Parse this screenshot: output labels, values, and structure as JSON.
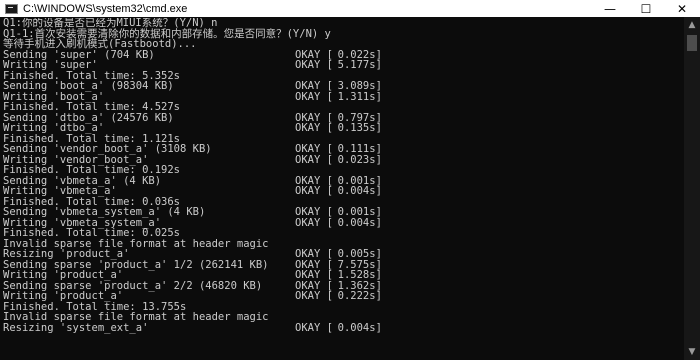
{
  "window": {
    "title": "C:\\WINDOWS\\system32\\cmd.exe",
    "minimize": "—",
    "maximize": "☐",
    "close": "✕"
  },
  "scrollbar": {
    "up": "▲",
    "down": "▼"
  },
  "console": {
    "lines": [
      {
        "left": "Q1:你的设备是否已经为MIUI系统？(Y/N) n"
      },
      {
        "left": "Q1-1:首次安装需要清除你的数据和内部存储。您是否同意？(Y/N) y"
      },
      {
        "left": "等待手机进入刷机模式(Fastbootd)..."
      },
      {
        "left": "Sending 'super' (704 KB)",
        "status": "OKAY [",
        "time": "  0.022s]"
      },
      {
        "left": "Writing 'super'",
        "status": "OKAY [",
        "time": "  5.177s]"
      },
      {
        "left": "Finished. Total time: 5.352s"
      },
      {
        "left": "Sending 'boot_a' (98304 KB)",
        "status": "OKAY [",
        "time": "  3.089s]"
      },
      {
        "left": "Writing 'boot_a'",
        "status": "OKAY [",
        "time": "  1.311s]"
      },
      {
        "left": "Finished. Total time: 4.527s"
      },
      {
        "left": "Sending 'dtbo_a' (24576 KB)",
        "status": "OKAY [",
        "time": "  0.797s]"
      },
      {
        "left": "Writing 'dtbo_a'",
        "status": "OKAY [",
        "time": "  0.135s]"
      },
      {
        "left": "Finished. Total time: 1.121s"
      },
      {
        "left": "Sending 'vendor_boot_a' (3108 KB)",
        "status": "OKAY [",
        "time": "  0.111s]"
      },
      {
        "left": "Writing 'vendor_boot_a'",
        "status": "OKAY [",
        "time": "  0.023s]"
      },
      {
        "left": "Finished. Total time: 0.192s"
      },
      {
        "left": "Sending 'vbmeta_a' (4 KB)",
        "status": "OKAY [",
        "time": "  0.001s]"
      },
      {
        "left": "Writing 'vbmeta_a'",
        "status": "OKAY [",
        "time": "  0.004s]"
      },
      {
        "left": "Finished. Total time: 0.036s"
      },
      {
        "left": "Sending 'vbmeta_system_a' (4 KB)",
        "status": "OKAY [",
        "time": "  0.001s]"
      },
      {
        "left": "Writing 'vbmeta_system_a'",
        "status": "OKAY [",
        "time": "  0.004s]"
      },
      {
        "left": "Finished. Total time: 0.025s"
      },
      {
        "left": "Invalid sparse file format at header magic"
      },
      {
        "left": "Resizing 'product_a'",
        "status": "OKAY [",
        "time": "  0.005s]"
      },
      {
        "left": "Sending sparse 'product_a' 1/2 (262141 KB)",
        "status": "OKAY [",
        "time": "  7.575s]"
      },
      {
        "left": "Writing 'product_a'",
        "status": "OKAY [",
        "time": "  1.528s]"
      },
      {
        "left": "Sending sparse 'product_a' 2/2 (46820 KB)",
        "status": "OKAY [",
        "time": "  1.362s]"
      },
      {
        "left": "Writing 'product_a'",
        "status": "OKAY [",
        "time": "  0.222s]"
      },
      {
        "left": "Finished. Total time: 13.755s"
      },
      {
        "left": "Invalid sparse file format at header magic"
      },
      {
        "left": "Resizing 'system_ext_a'",
        "status": "OKAY [",
        "time": "  0.004s]"
      }
    ]
  }
}
